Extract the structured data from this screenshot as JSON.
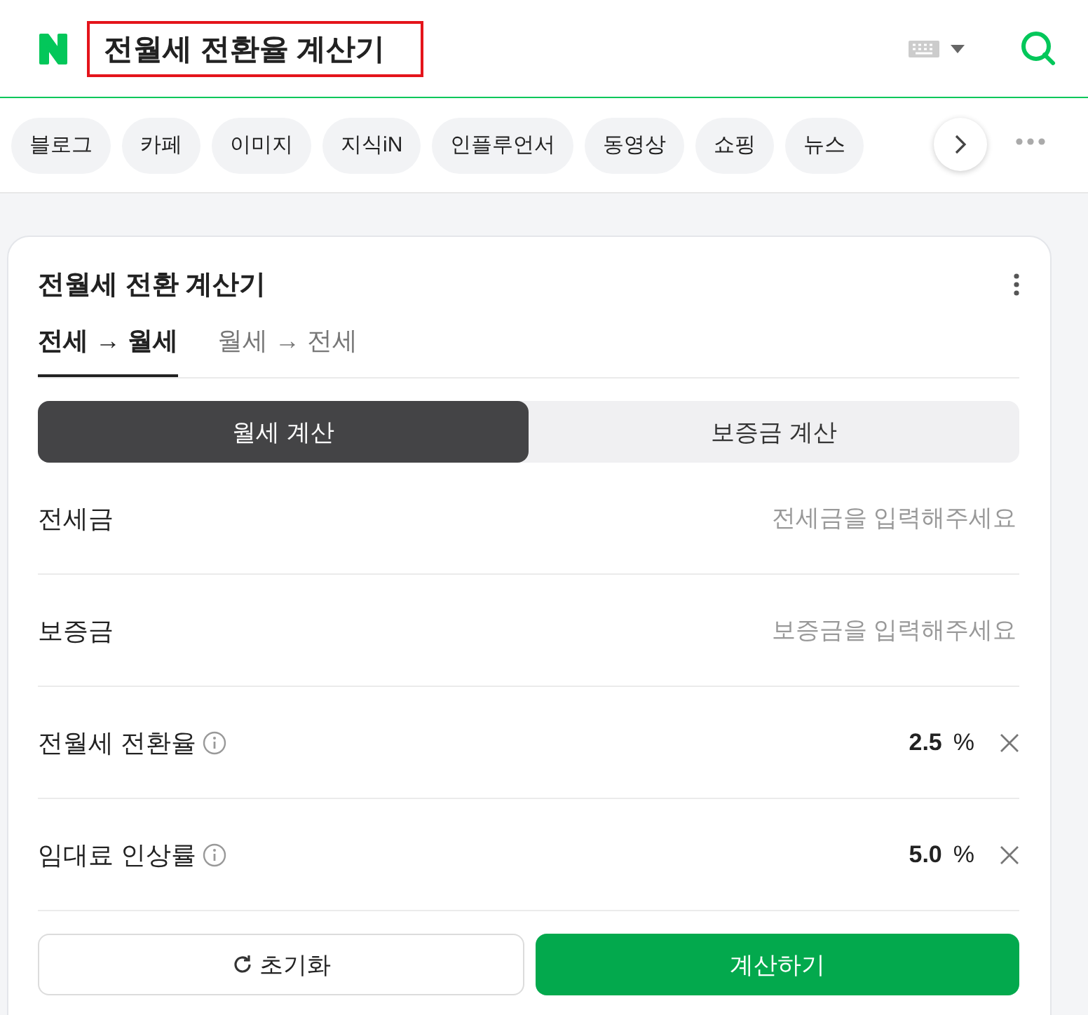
{
  "header": {
    "query": "전월세 전환율 계산기"
  },
  "chips": [
    {
      "label": "블로그"
    },
    {
      "label": "카페"
    },
    {
      "label": "이미지"
    },
    {
      "label": "지식iN"
    },
    {
      "label": "인플루언서"
    },
    {
      "label": "동영상"
    },
    {
      "label": "쇼핑"
    },
    {
      "label": "뉴스"
    }
  ],
  "card": {
    "title": "전월세 전환 계산기",
    "tabs": [
      {
        "label": "전세 → 월세",
        "selected": true
      },
      {
        "label": "월세 → 전세",
        "selected": false
      }
    ],
    "segments": [
      {
        "label": "월세 계산",
        "selected": true
      },
      {
        "label": "보증금 계산",
        "selected": false
      }
    ],
    "fields": [
      {
        "kind": "input",
        "label": "전세금",
        "placeholder": "전세금을 입력해주세요"
      },
      {
        "kind": "input",
        "label": "보증금",
        "placeholder": "보증금을 입력해주세요"
      },
      {
        "kind": "value",
        "label": "전월세 전환율",
        "value": "2.5",
        "unit": "%"
      },
      {
        "kind": "value",
        "label": "임대료 인상률",
        "value": "5.0",
        "unit": "%"
      }
    ],
    "reset_button": "초기화",
    "calculate_button": "계산하기"
  }
}
